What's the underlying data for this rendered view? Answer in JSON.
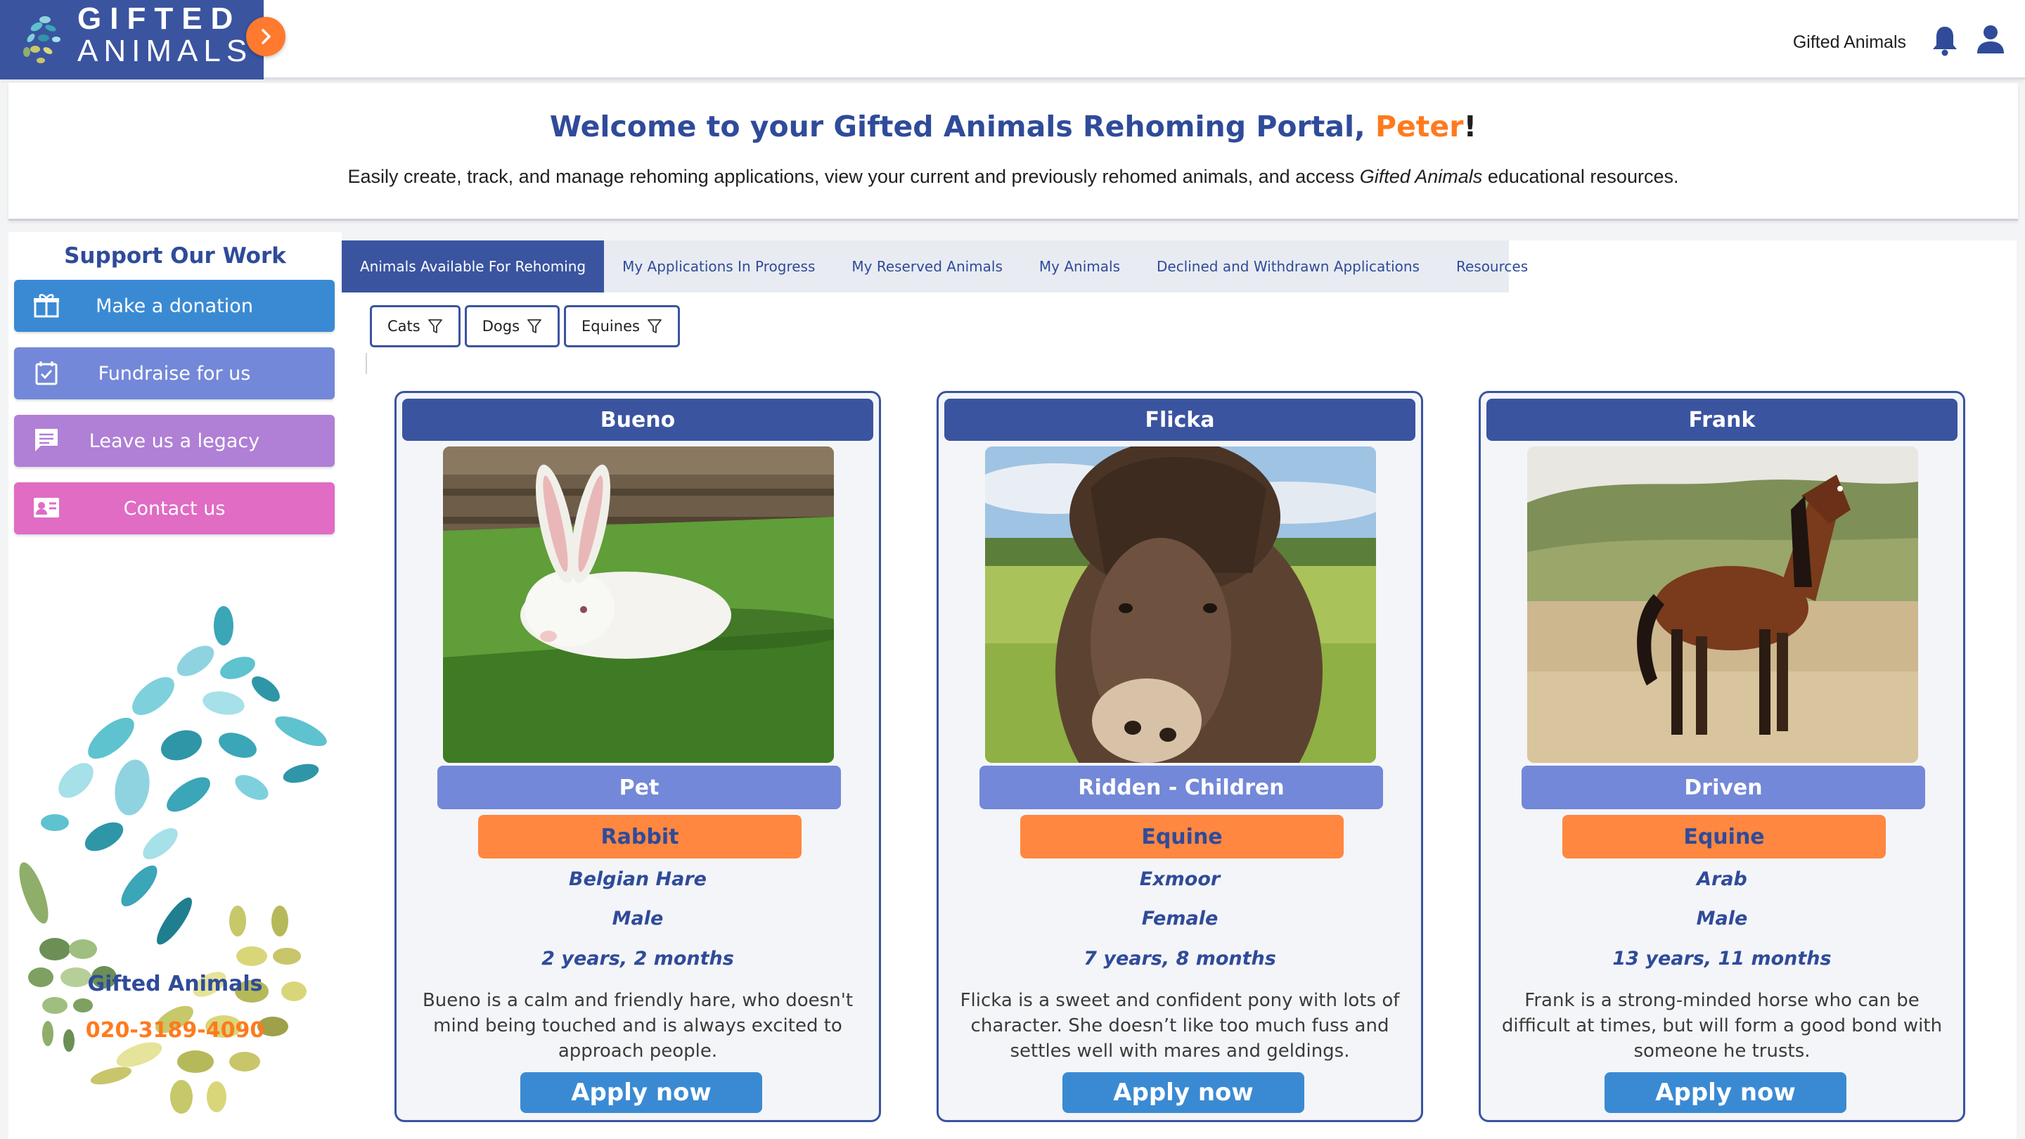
{
  "header": {
    "logo_line1": "GIFTED",
    "logo_line2": "ANIMALS",
    "org_name": "Gifted Animals",
    "toggle_icon": "chevron-right-icon",
    "notifications_icon": "bell-icon",
    "account_icon": "user-icon"
  },
  "welcome": {
    "title_prefix": "Welcome to your Gifted Animals Rehoming Portal, ",
    "user_name": "Peter",
    "title_suffix": "!",
    "subtitle_part1": "Easily create, track, and manage rehoming applications, view your current and previously rehomed animals, and access ",
    "subtitle_emphasis": "Gifted Animals",
    "subtitle_part2": " educational resources."
  },
  "sidebar": {
    "title": "Support Our Work",
    "buttons": [
      {
        "label": "Make a donation",
        "icon": "gift-icon",
        "color": "#3a8ad3"
      },
      {
        "label": "Fundraise for us",
        "icon": "calendar-check-icon",
        "color": "#7388d8"
      },
      {
        "label": "Leave us a legacy",
        "icon": "message-icon",
        "color": "#b07fd6"
      },
      {
        "label": "Contact us",
        "icon": "contact-card-icon",
        "color": "#e06cc4"
      }
    ],
    "org_name": "Gifted Animals",
    "phone": "020-3189-4090"
  },
  "tabs": [
    {
      "label": "Animals Available For Rehoming",
      "active": true
    },
    {
      "label": "My Applications In Progress",
      "active": false
    },
    {
      "label": "My Reserved Animals",
      "active": false
    },
    {
      "label": "My Animals",
      "active": false
    },
    {
      "label": "Declined and Withdrawn Applications",
      "active": false
    },
    {
      "label": "Resources",
      "active": false
    }
  ],
  "filters": [
    {
      "label": "Cats",
      "icon": "filter-icon"
    },
    {
      "label": "Dogs",
      "icon": "filter-icon"
    },
    {
      "label": "Equines",
      "icon": "filter-icon"
    }
  ],
  "animals": [
    {
      "name": "Bueno",
      "role": "Pet",
      "species": "Rabbit",
      "breed": "Belgian Hare",
      "sex": "Male",
      "age": "2 years, 2 months",
      "description": "Bueno is a calm and friendly hare, who doesn't mind being touched and is always excited to approach people.",
      "apply_label": "Apply now"
    },
    {
      "name": "Flicka",
      "role": "Ridden - Children",
      "species": "Equine",
      "breed": "Exmoor",
      "sex": "Female",
      "age": "7 years, 8 months",
      "description": "Flicka is a sweet and confident pony with lots of character. She doesn’t like too much fuss and settles well with mares and geldings.",
      "apply_label": "Apply now"
    },
    {
      "name": "Frank",
      "role": "Driven",
      "species": "Equine",
      "breed": "Arab",
      "sex": "Male",
      "age": "13 years, 11 months",
      "description": "Frank is a strong-minded horse who can be difficult at times, but will form a good bond with someone he trusts.",
      "apply_label": "Apply now"
    }
  ],
  "colors": {
    "brand_blue": "#3a54a0",
    "accent_orange": "#ff7a1e",
    "button_blue": "#3a8ad3",
    "role_purple": "#7388d8"
  }
}
